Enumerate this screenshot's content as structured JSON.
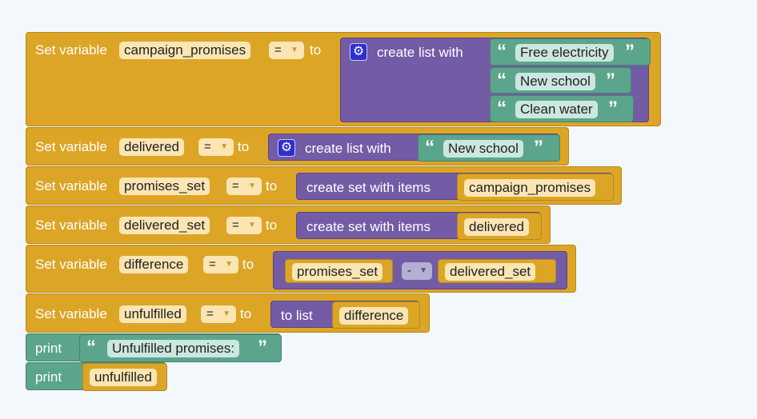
{
  "labels": {
    "set_variable": "Set variable",
    "to": "to",
    "eq": "=",
    "create_list_with": "create list with",
    "create_set_with_items": "create set with items",
    "to_list": "to list",
    "minus": "-",
    "print": "print"
  },
  "blocks": [
    {
      "var": "campaign_promises",
      "items": [
        "Free electricity",
        "New school",
        "Clean water"
      ]
    },
    {
      "var": "delivered",
      "items": [
        "New school"
      ]
    },
    {
      "var": "promises_set",
      "arg": "campaign_promises"
    },
    {
      "var": "delivered_set",
      "arg": "delivered"
    },
    {
      "var": "difference",
      "left": "promises_set",
      "right": "delivered_set"
    },
    {
      "var": "unfulfilled",
      "arg": "difference"
    }
  ],
  "prints": [
    {
      "text": "Unfulfilled promises:"
    },
    {
      "var": "unfulfilled"
    }
  ],
  "colors": {
    "variables": "#dca526",
    "lists": "#745ba6",
    "text": "#5ba58c",
    "pill": "#fae5b3",
    "background": "#f3f8fd"
  },
  "icons": {
    "gear": "gear-icon",
    "dropdown": "dropdown-arrow-icon",
    "open_quote": "open-quote-icon",
    "close_quote": "close-quote-icon"
  }
}
